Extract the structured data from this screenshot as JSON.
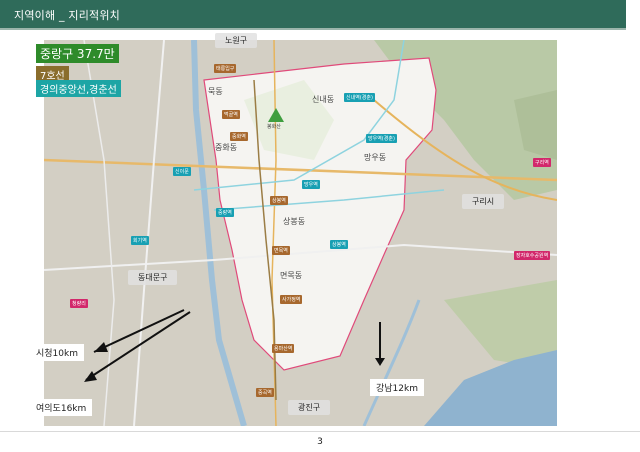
{
  "header": {
    "title": "지역이해 _ 지리적위치"
  },
  "info": {
    "district_pop": "중랑구 37.7만",
    "line7": "7호선",
    "lines": "경의중앙선,경춘선"
  },
  "districts": {
    "nowon": "노원구",
    "dongdaemun": "동대문구",
    "guri": "구리시",
    "gwangjin": "광진구"
  },
  "dongs": {
    "muk": "묵동",
    "sinnae": "신내동",
    "junghwa": "중화동",
    "mangu": "망우동",
    "sangbong": "상봉동",
    "myeonmok": "면목동"
  },
  "landmark": "봉화산",
  "stations": {
    "taereung": "태릉입구",
    "meokgol": "먹골역",
    "junghwa": "중화역",
    "sinnae": "신내역(경춘)",
    "mangu": "망우역(경춘)",
    "mangu2": "망우역",
    "sangbong": "상봉역",
    "jungnang": "중랑역",
    "sangbong2": "상봉역",
    "myeonmok": "면목역",
    "sagajeong": "사가정역",
    "yongmasan": "용마산역",
    "junggok": "중곡역",
    "sinimun": "신이문",
    "hoegi": "회기역",
    "cheongnyangni": "청량리",
    "guri": "구리역",
    "guriwon": "장자호수공원역"
  },
  "callouts": {
    "cityhall": "시청10km",
    "yeouido": "여의도16km",
    "gangnam": "강남12km"
  },
  "page": {
    "number": "3"
  }
}
